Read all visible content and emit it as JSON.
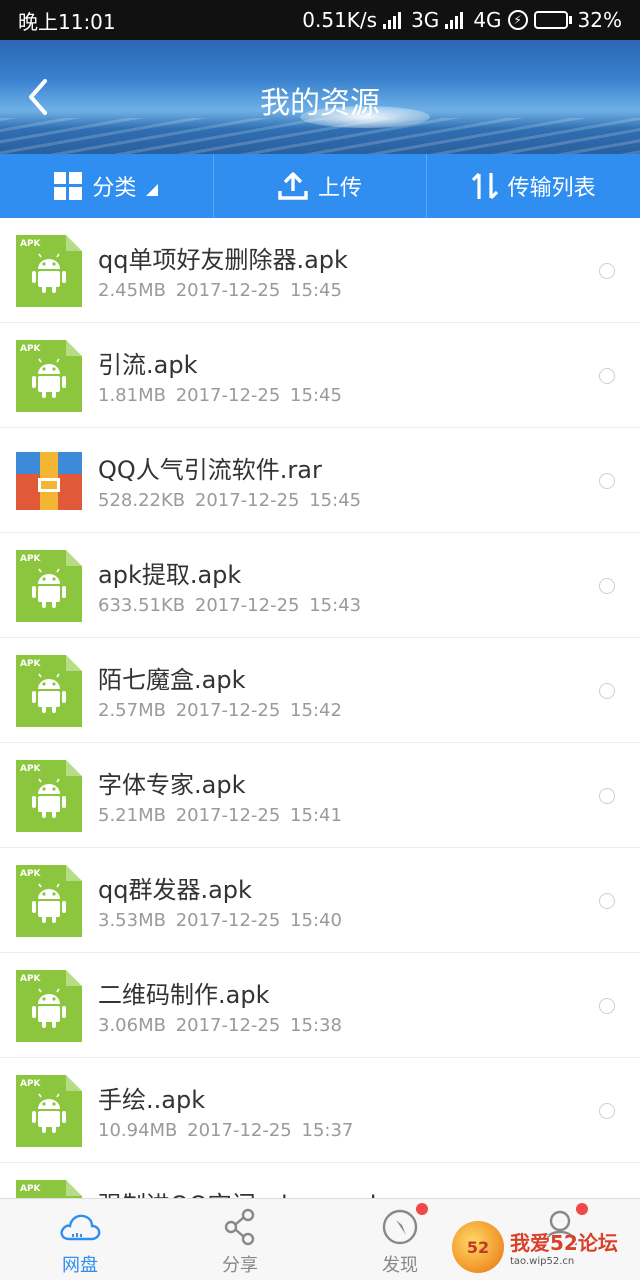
{
  "status_bar": {
    "time": "晚上11:01",
    "speed": "0.51K/s",
    "network_1": "3G",
    "network_2": "4G",
    "battery": "32%",
    "battery_fill_fraction": 0.32,
    "icons": [
      "signal-icon",
      "charging-bolt-icon",
      "battery-icon"
    ]
  },
  "header": {
    "title": "我的资源",
    "back_icon": "chevron-left-icon"
  },
  "toolbar": {
    "category_label": "分类",
    "upload_label": "上传",
    "transfer_label": "传输列表"
  },
  "files": [
    {
      "name": "qq单项好友删除器.apk",
      "size": "2.45MB",
      "date": "2017-12-25",
      "time": "15:45",
      "type": "apk"
    },
    {
      "name": "引流.apk",
      "size": "1.81MB",
      "date": "2017-12-25",
      "time": "15:45",
      "type": "apk"
    },
    {
      "name": "QQ人气引流软件.rar",
      "size": "528.22KB",
      "date": "2017-12-25",
      "time": "15:45",
      "type": "rar"
    },
    {
      "name": "apk提取.apk",
      "size": "633.51KB",
      "date": "2017-12-25",
      "time": "15:43",
      "type": "apk"
    },
    {
      "name": "陌七魔盒.apk",
      "size": "2.57MB",
      "date": "2017-12-25",
      "time": "15:42",
      "type": "apk"
    },
    {
      "name": "字体专家.apk",
      "size": "5.21MB",
      "date": "2017-12-25",
      "time": "15:41",
      "type": "apk"
    },
    {
      "name": "qq群发器.apk",
      "size": "3.53MB",
      "date": "2017-12-25",
      "time": "15:40",
      "type": "apk"
    },
    {
      "name": "二维码制作.apk",
      "size": "3.06MB",
      "date": "2017-12-25",
      "time": "15:38",
      "type": "apk"
    },
    {
      "name": "手绘..apk",
      "size": "10.94MB",
      "date": "2017-12-25",
      "time": "15:37",
      "type": "apk"
    },
    {
      "name": "强制进QQ空间_clone.apk",
      "size": "",
      "date": "",
      "time": "",
      "type": "apk"
    }
  ],
  "apk_badge": "APK",
  "bottom_nav": [
    {
      "label": "网盘",
      "icon": "cloud-icon",
      "active": true,
      "badge": false
    },
    {
      "label": "分享",
      "icon": "share-icon",
      "active": false,
      "badge": false
    },
    {
      "label": "发现",
      "icon": "compass-icon",
      "active": false,
      "badge": true
    },
    {
      "label": "",
      "icon": "profile-icon",
      "active": false,
      "badge": true
    }
  ],
  "watermark": {
    "logo_text": "52",
    "title": "我爱52论坛",
    "url": "tao.wip52.cn"
  },
  "colors": {
    "accent": "#2f8ef0",
    "apk_green": "#8cc63f",
    "badge_red": "#f04848"
  }
}
